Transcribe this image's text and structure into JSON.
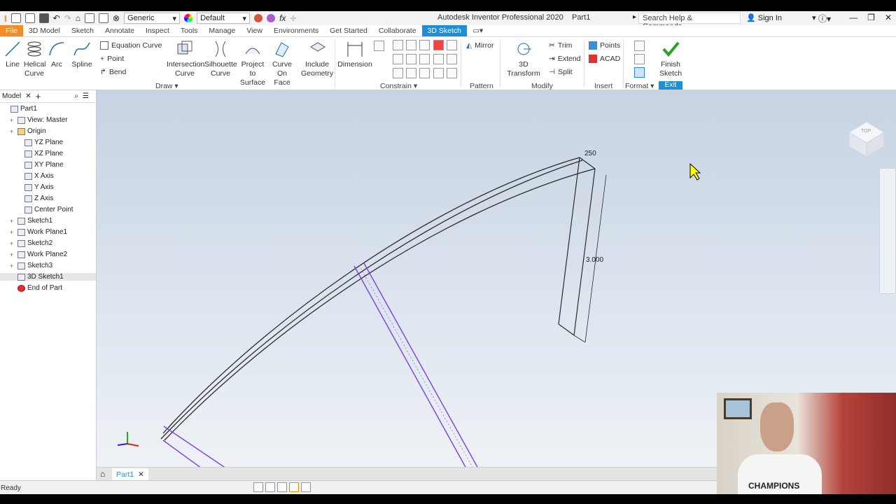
{
  "title_bar": {
    "appearance_combo": "Generic",
    "material_combo": "Default",
    "app_title": "Autodesk Inventor Professional 2020",
    "doc_name": "Part1",
    "search_placeholder": "Search Help & Commands...",
    "sign_in": "Sign In"
  },
  "menu_tabs": [
    "File",
    "3D Model",
    "Sketch",
    "Annotate",
    "Inspect",
    "Tools",
    "Manage",
    "View",
    "Environments",
    "Get Started",
    "Collaborate",
    "3D Sketch"
  ],
  "active_tab": "3D Sketch",
  "ribbon": {
    "draw": {
      "line": "Line",
      "helical_curve": "Helical Curve",
      "arc": "Arc",
      "spline": "Spline",
      "equation_curve": "Equation Curve",
      "point": "Point",
      "bend": "Bend",
      "intersection_curve": "Intersection Curve",
      "silhouette_curve": "Silhouette Curve",
      "project_to_surface": "Project to Surface",
      "curve_on_face": "Curve On Face",
      "include_geometry": "Include Geometry",
      "panel": "Draw"
    },
    "constrain": {
      "dimension": "Dimension",
      "panel": "Constrain"
    },
    "pattern": {
      "mirror": "Mirror",
      "panel": "Pattern"
    },
    "modify": {
      "transform": "3D Transform",
      "trim": "Trim",
      "extend": "Extend",
      "split": "Split",
      "panel": "Modify"
    },
    "insert": {
      "points": "Points",
      "acad": "ACAD",
      "panel": "Insert"
    },
    "format": {
      "panel": "Format"
    },
    "exit": {
      "finish_sketch": "Finish Sketch",
      "panel": "Exit"
    }
  },
  "browser": {
    "tab_label": "Model",
    "items": [
      {
        "label": "Part1",
        "icon": "part-icon"
      },
      {
        "label": "View: Master",
        "icon": "view-icon"
      },
      {
        "label": "Origin",
        "icon": "folder-icon"
      },
      {
        "label": "YZ Plane",
        "icon": "plane-icon"
      },
      {
        "label": "XZ Plane",
        "icon": "plane-icon"
      },
      {
        "label": "XY Plane",
        "icon": "plane-icon"
      },
      {
        "label": "X Axis",
        "icon": "axis-icon"
      },
      {
        "label": "Y Axis",
        "icon": "axis-icon"
      },
      {
        "label": "Z Axis",
        "icon": "axis-icon"
      },
      {
        "label": "Center Point",
        "icon": "point-icon"
      },
      {
        "label": "Sketch1",
        "icon": "sketch-icon"
      },
      {
        "label": "Work Plane1",
        "icon": "plane-icon"
      },
      {
        "label": "Sketch2",
        "icon": "sketch-icon"
      },
      {
        "label": "Work Plane2",
        "icon": "plane-icon"
      },
      {
        "label": "Sketch3",
        "icon": "sketch-icon"
      },
      {
        "label": "3D Sketch1",
        "icon": "3d-sketch-icon"
      },
      {
        "label": "End of Part",
        "icon": "end-of-part-icon"
      }
    ]
  },
  "viewport": {
    "dim_top": "250",
    "dim_side": "3.000",
    "viewcube_label": "TOP"
  },
  "doc_tab": "Part1",
  "status": "Ready",
  "webcam": {
    "shirt_text": "CHAMPIONS"
  },
  "colors": {
    "accent": "#1e8fd6",
    "file_tab": "#f28c28",
    "sketch_purple": "#7b3fe4"
  }
}
